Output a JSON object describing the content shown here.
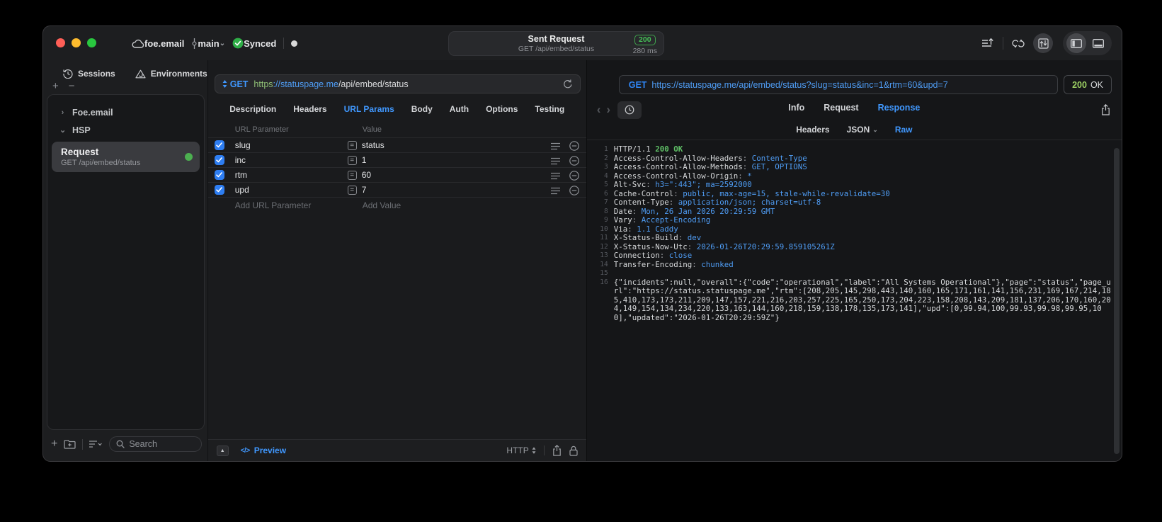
{
  "titlebar": {
    "project": "foe.email",
    "branch": "main",
    "sync_status": "Synced",
    "request_title": "Sent Request",
    "request_subtitle": "GET /api/embed/status",
    "status_code": "200",
    "duration": "280 ms"
  },
  "glyphs": {
    "chevron_collapsed": "›",
    "chevron_expanded": "⌄",
    "chevron_down": "⌄",
    "plus": "+",
    "minus": "−",
    "collapse_up": "▲",
    "nav_back": "‹",
    "nav_forward": "›",
    "code_tag": "</>",
    "equals": "="
  },
  "sidebar": {
    "tabs": [
      {
        "label": "Sessions"
      },
      {
        "label": "Environments"
      }
    ],
    "tree": [
      {
        "label": "Foe.email"
      },
      {
        "label": "HSP"
      }
    ],
    "request_item": {
      "title": "Request",
      "subtitle": "GET /api/embed/status"
    },
    "search_placeholder": "Search"
  },
  "request_panel": {
    "method": "GET",
    "url_scheme": "https",
    "url_host": "://statuspage.me",
    "url_path": "/api/embed/status",
    "tabs": [
      "Description",
      "Headers",
      "URL Params",
      "Body",
      "Auth",
      "Options",
      "Testing"
    ],
    "active_tab": "URL Params",
    "param_table": {
      "columns": [
        "URL Parameter",
        "Value"
      ],
      "rows": [
        {
          "name": "slug",
          "value": "status",
          "enabled": true
        },
        {
          "name": "inc",
          "value": "1",
          "enabled": true
        },
        {
          "name": "rtm",
          "value": "60",
          "enabled": true
        },
        {
          "name": "upd",
          "value": "7",
          "enabled": true
        }
      ],
      "add_name_placeholder": "Add URL Parameter",
      "add_value_placeholder": "Add Value"
    },
    "footer": {
      "preview_label": "Preview",
      "protocol": "HTTP"
    }
  },
  "response_panel": {
    "method": "GET",
    "url": "https://statuspage.me/api/embed/status?slug=status&inc=1&rtm=60&upd=7",
    "status_code": "200",
    "status_text": "OK",
    "tabs": [
      "Info",
      "Request",
      "Response"
    ],
    "active_tab": "Response",
    "view_tabs": [
      {
        "label": "Headers",
        "chevron": false
      },
      {
        "label": "JSON",
        "chevron": true
      },
      {
        "label": "Raw",
        "chevron": false
      }
    ],
    "active_view": "Raw",
    "status_line": {
      "protocol": "HTTP/1.1",
      "status": "200 OK"
    },
    "headers": [
      [
        "Access-Control-Allow-Headers",
        "Content-Type"
      ],
      [
        "Access-Control-Allow-Methods",
        "GET, OPTIONS"
      ],
      [
        "Access-Control-Allow-Origin",
        "*"
      ],
      [
        "Alt-Svc",
        "h3=\":443\"; ma=2592000"
      ],
      [
        "Cache-Control",
        "public, max-age=15, stale-while-revalidate=30"
      ],
      [
        "Content-Type",
        "application/json; charset=utf-8"
      ],
      [
        "Date",
        "Mon, 26 Jan 2026 20:29:59 GMT"
      ],
      [
        "Vary",
        "Accept-Encoding"
      ],
      [
        "Via",
        "1.1 Caddy"
      ],
      [
        "X-Status-Build",
        "dev"
      ],
      [
        "X-Status-Now-Utc",
        "2026-01-26T20:29:59.859105261Z"
      ],
      [
        "Connection",
        "close"
      ],
      [
        "Transfer-Encoding",
        "chunked"
      ]
    ],
    "body": "{\"incidents\":null,\"overall\":{\"code\":\"operational\",\"label\":\"All Systems Operational\"},\"page\":\"status\",\"page_url\":\"https://status.statuspage.me\",\"rtm\":[208,205,145,298,443,140,160,165,171,161,141,156,231,169,167,214,185,410,173,173,211,209,147,157,221,216,203,257,225,165,250,173,204,223,158,208,143,209,181,137,206,170,160,204,149,154,134,234,220,133,163,144,160,218,159,138,178,135,173,141],\"upd\":[0,99.94,100,99.93,99.98,99.95,100],\"updated\":\"2026-01-26T20:29:59Z\"}"
  }
}
